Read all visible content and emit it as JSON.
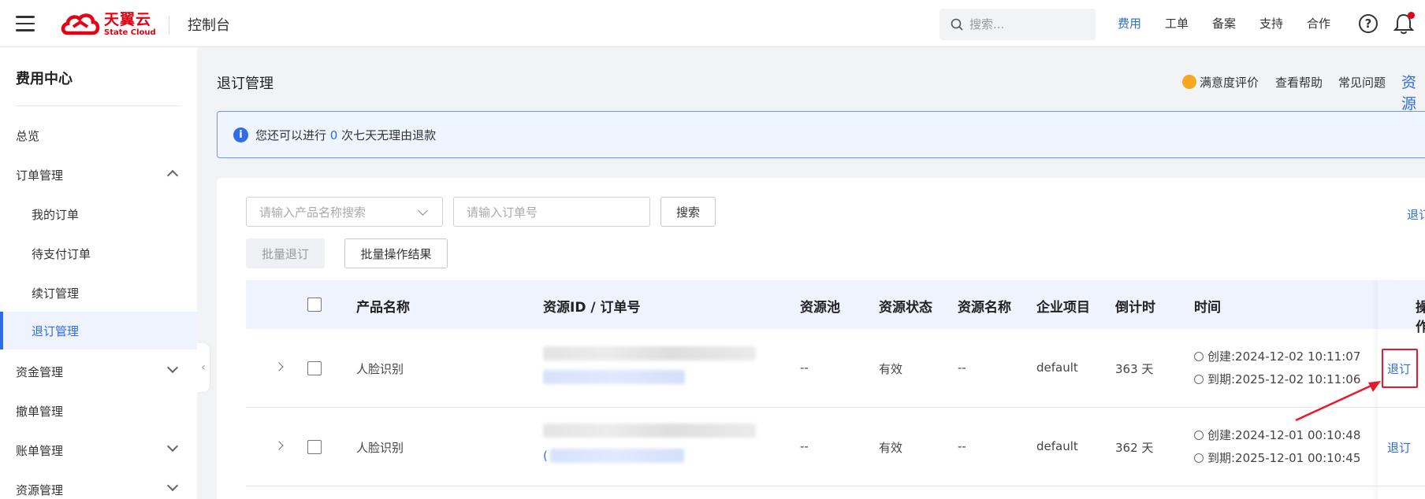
{
  "topbar": {
    "logo_cn": "天翼云",
    "logo_en": "State Cloud",
    "console_label": "控制台",
    "search_placeholder": "搜索...",
    "nav": [
      "费用",
      "工单",
      "备案",
      "支持",
      "合作"
    ],
    "active_nav": "费用",
    "help_symbol": "?"
  },
  "sidebar": {
    "title": "费用中心",
    "items": [
      {
        "label": "总览"
      },
      {
        "label": "订单管理"
      },
      {
        "label": "我的订单"
      },
      {
        "label": "待支付订单"
      },
      {
        "label": "续订管理"
      },
      {
        "label": "退订管理"
      },
      {
        "label": "资金管理"
      },
      {
        "label": "撤单管理"
      },
      {
        "label": "账单管理"
      },
      {
        "label": "资源管理"
      }
    ],
    "collapse_symbol": "‹"
  },
  "header": {
    "title": "退订管理",
    "links": [
      "满意度评价",
      "查看帮助",
      "常见问题"
    ],
    "resource_link": "资源"
  },
  "notice": {
    "text_before": "您还可以进行 ",
    "count": "0",
    "text_after": " 次七天无理由退款"
  },
  "filters": {
    "product_placeholder": "请输入产品名称搜索",
    "order_placeholder": "请输入订单号",
    "search_button": "搜索",
    "batch_unsubscribe": "批量退订",
    "batch_results": "批量操作结果",
    "right_link": "退订"
  },
  "table": {
    "headers": [
      "产品名称",
      "资源ID / 订单号",
      "资源池",
      "资源状态",
      "资源名称",
      "企业项目",
      "倒计时",
      "时间",
      "操作"
    ],
    "rows": [
      {
        "product": "人脸识别",
        "pool": "--",
        "status": "有效",
        "name": "--",
        "project": "default",
        "countdown": "363 天",
        "created": "创建:2024-12-02 10:11:07",
        "expires": "到期:2025-12-02 10:11:06",
        "action": "退订"
      },
      {
        "product": "人脸识别",
        "pool": "--",
        "status": "有效",
        "name": "--",
        "project": "default",
        "countdown": "362 天",
        "created": "创建:2024-12-01 00:10:48",
        "expires": "到期:2025-12-01 00:10:45",
        "action": "退订",
        "id_prefix": "("
      }
    ]
  },
  "colors": {
    "accent": "#2f6ce5",
    "brand_red": "#e60012",
    "annotation_red": "#e8192c"
  }
}
